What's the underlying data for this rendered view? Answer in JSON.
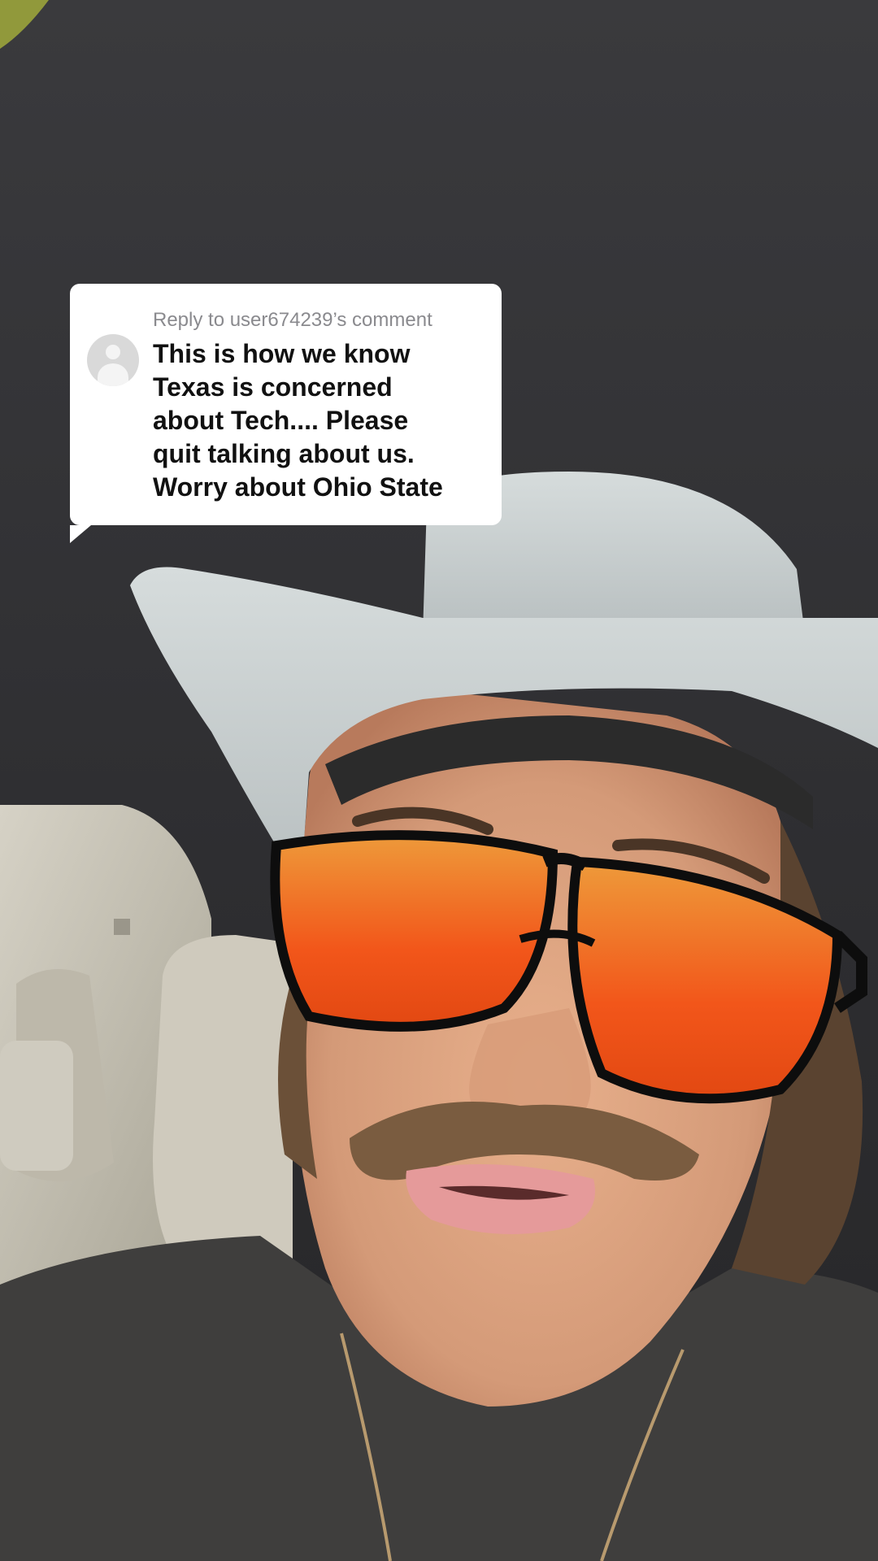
{
  "reply_sticker": {
    "header": "Reply to user674239’s comment",
    "comment_lines": [
      "This is how we know",
      "Texas is concerned",
      "about Tech.... Please",
      "quit talking about us.",
      "Worry about Ohio State"
    ]
  },
  "icons": {
    "avatar": "default-user-avatar-icon"
  }
}
